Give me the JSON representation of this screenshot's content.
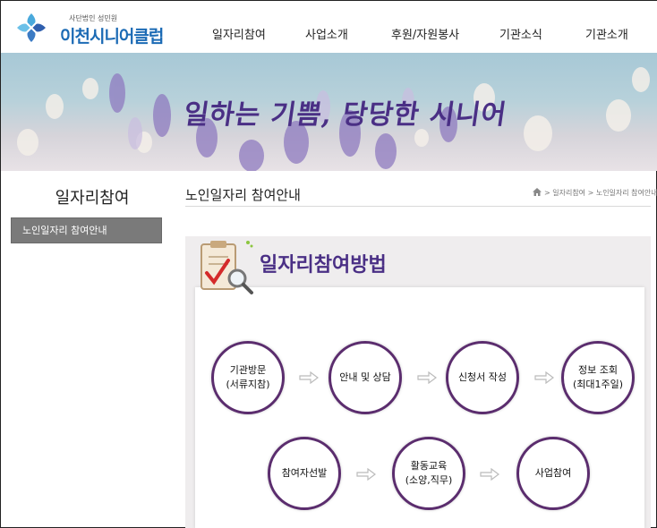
{
  "logo": {
    "subtitle": "사단법인 성민원",
    "name": "이천시니어클럽"
  },
  "gnb": [
    {
      "label": "일자리참여"
    },
    {
      "label": "사업소개"
    },
    {
      "label": "후원/자원봉사"
    },
    {
      "label": "기관소식"
    },
    {
      "label": "기관소개"
    }
  ],
  "banner": {
    "title": "일하는 기쁨, 당당한 시니어"
  },
  "lnb": {
    "title": "일자리참여",
    "items": [
      {
        "label": "노인일자리 참여안내",
        "active": true
      }
    ]
  },
  "page": {
    "title": "노인일자리 참여안내",
    "breadcrumb": "> 일자리참여 > 노인일자리 참여안내"
  },
  "content": {
    "section_title": "일자리참여방법",
    "steps": [
      {
        "label": "기관방문\n(서류지참)"
      },
      {
        "label": "안내 및 상담"
      },
      {
        "label": "신청서 작성"
      },
      {
        "label": "정보 조회\n(최대1주일)"
      },
      {
        "label": "참여자선발"
      },
      {
        "label": "활동교육\n(소양,직무)"
      },
      {
        "label": "사업참여"
      }
    ]
  },
  "colors": {
    "brand_blue": "#1c6bb5",
    "brand_purple": "#4a2f85",
    "circle_border": "#5b2d6e",
    "lnb_active_bg": "#7a7a7a"
  }
}
